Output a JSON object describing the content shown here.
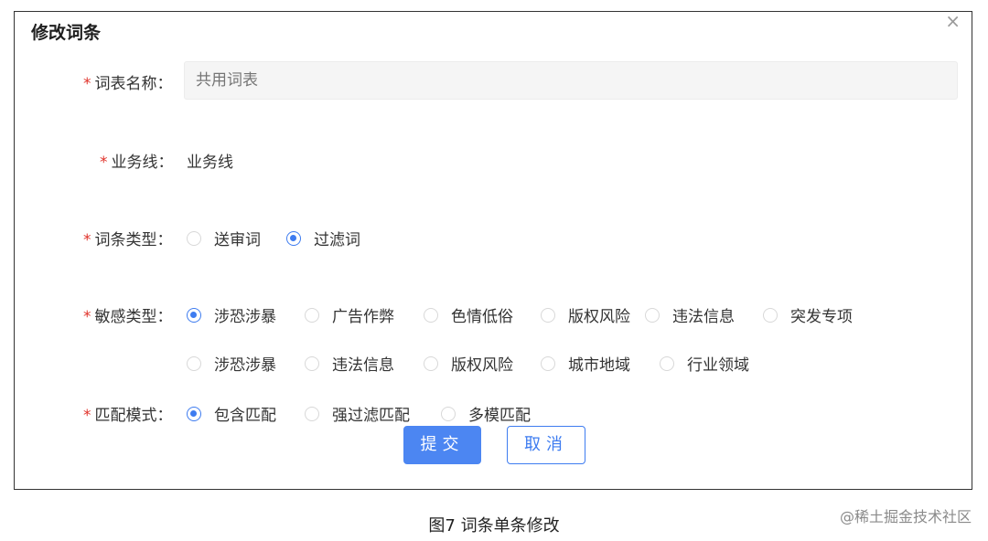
{
  "dialog": {
    "title": "修改词条",
    "close_icon": "×"
  },
  "form": {
    "required_mark": "*",
    "wordlist_name": {
      "label": "词表名称：",
      "placeholder": "共用词表"
    },
    "business_line": {
      "label": "业务线：",
      "value": "业务线"
    },
    "entry_type": {
      "label": "词条类型：",
      "options": [
        {
          "label": "送审词",
          "selected": false
        },
        {
          "label": "过滤词",
          "selected": true
        }
      ]
    },
    "sensitive_type": {
      "label": "敏感类型：",
      "options": [
        {
          "label": "涉恐涉暴",
          "selected": true
        },
        {
          "label": "广告作弊",
          "selected": false
        },
        {
          "label": "色情低俗",
          "selected": false
        },
        {
          "label": "版权风险",
          "selected": false
        },
        {
          "label": "违法信息",
          "selected": false
        },
        {
          "label": "突发专项",
          "selected": false
        },
        {
          "label": "涉恐涉暴",
          "selected": false
        },
        {
          "label": "违法信息",
          "selected": false
        },
        {
          "label": "版权风险",
          "selected": false
        },
        {
          "label": "城市地域",
          "selected": false
        },
        {
          "label": "行业领域",
          "selected": false
        }
      ]
    },
    "match_mode": {
      "label": "匹配模式：",
      "options": [
        {
          "label": "包含匹配",
          "selected": true
        },
        {
          "label": "强过滤匹配",
          "selected": false
        },
        {
          "label": "多模匹配",
          "selected": false
        }
      ]
    }
  },
  "buttons": {
    "submit": "提交",
    "cancel": "取消"
  },
  "caption": "图7 词条单条修改",
  "watermark": "@稀土掘金技术社区",
  "colors": {
    "accent": "#3e7cf0",
    "required": "#e0322a",
    "button_bg": "#4c86f2"
  }
}
